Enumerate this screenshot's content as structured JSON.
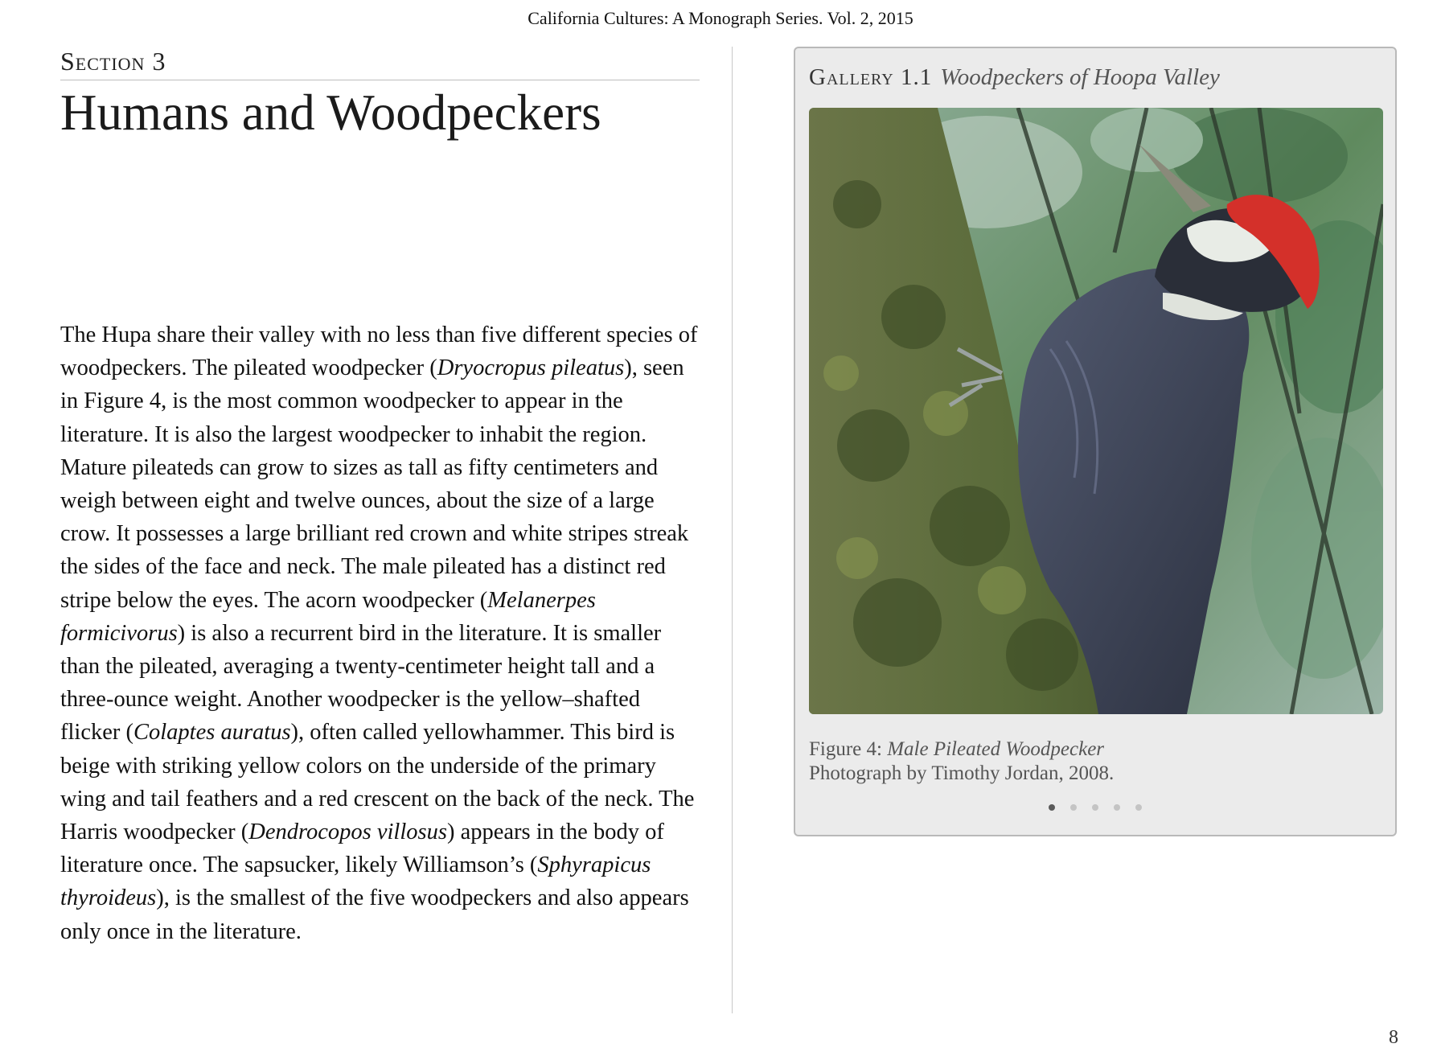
{
  "header": {
    "running_title": "California Cultures: A Monograph Series. Vol.  2, 2015"
  },
  "section": {
    "label": "Section 3",
    "title": "Humans and Woodpeckers"
  },
  "body": {
    "segments": [
      {
        "text": "The Hupa share their valley with no less than five different species of woodpeckers. The pileated woodpecker (",
        "italic": false
      },
      {
        "text": "Dryocropus pileatus",
        "italic": true
      },
      {
        "text": "), seen in Figure 4, is the most common woodpecker to appear in the literature. It is also the largest woodpecker to inhabit the region. Mature pileateds can grow to sizes as tall as fifty centimeters and weigh between eight and twelve ounces, about the size of a large crow. It possesses a large brilliant red crown and white stripes streak the sides of the face and neck. The male pileated has a distinct red stripe below the eyes. The acorn woodpecker (",
        "italic": false
      },
      {
        "text": "Melanerpes formicivorus",
        "italic": true
      },
      {
        "text": ") is also a recurrent bird in the literature. It is smaller than the pileated, averaging a twenty-centimeter height tall and a three-ounce weight. Another woodpecker is the yellow–shafted flicker (",
        "italic": false
      },
      {
        "text": "Colaptes auratus",
        "italic": true
      },
      {
        "text": "), often called yellowhammer. This bird is beige with striking yellow colors on the underside of the primary wing and tail feathers and a red crescent on the back of the neck. The Harris woodpecker (",
        "italic": false
      },
      {
        "text": "Dendrocopos villosus",
        "italic": true
      },
      {
        "text": ") appears in the body of literature once. The sapsucker, likely Williamson’s (",
        "italic": false
      },
      {
        "text": "Sphyrapicus thyroideus",
        "italic": true
      },
      {
        "text": "), is the smallest of the five woodpeckers and also appears only once in the literature.",
        "italic": false
      }
    ]
  },
  "gallery": {
    "label": "Gallery 1.1",
    "subtitle": "Woodpeckers of Hoopa Valley",
    "caption_prefix": "Figure 4: ",
    "caption_title": "Male Pileated Woodpecker",
    "caption_credit": "Photograph by Timothy Jordan, 2008.",
    "dot_count": 5,
    "active_dot": 0
  },
  "page_number": "8",
  "colors": {
    "crest": "#d4302a",
    "bird_body": "#3f4658",
    "moss": "#5a6b3a",
    "foliage": "#5f8a5e"
  }
}
